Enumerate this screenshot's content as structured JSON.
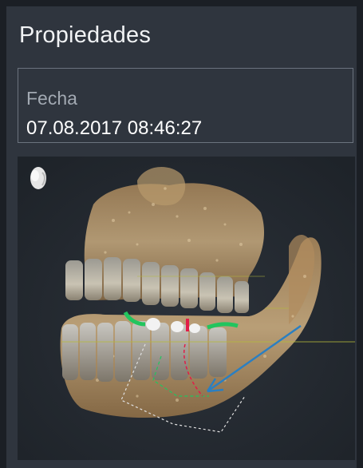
{
  "panel": {
    "title": "Propiedades"
  },
  "date_field": {
    "label": "Fecha",
    "value": "07.08.2017 08:46:27"
  },
  "preview": {
    "orientation_icon": "head-orientation-icon",
    "colors": {
      "background": "#23282f",
      "bone": "#c9ab7e",
      "bone_light": "#e8d6b6",
      "axis_green": "#22c55e",
      "axis_red": "#e11d48",
      "arrow_blue": "#2b7fc1",
      "guide_yellow": "#b5b93a"
    }
  }
}
